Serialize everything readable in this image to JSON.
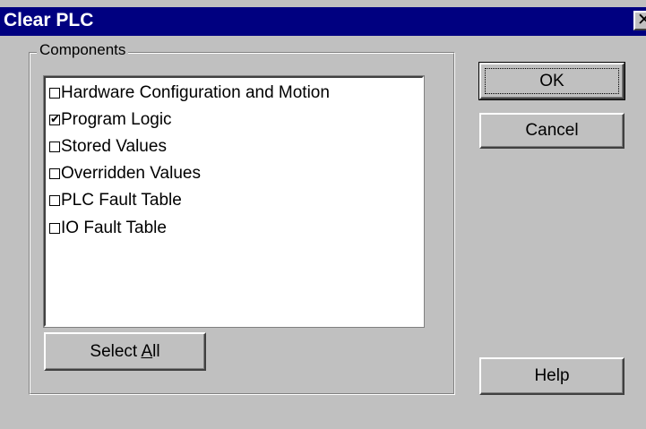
{
  "window": {
    "title": "Clear PLC",
    "close_glyph": "✕"
  },
  "components_group": {
    "label": "Components",
    "items": [
      {
        "label": "Hardware Configuration and Motion",
        "checked": false
      },
      {
        "label": "Program Logic",
        "checked": true
      },
      {
        "label": "Stored Values",
        "checked": false
      },
      {
        "label": "Overridden Values",
        "checked": false
      },
      {
        "label": "PLC Fault Table",
        "checked": false
      },
      {
        "label": "IO Fault Table",
        "checked": false
      }
    ],
    "select_all": {
      "prefix": "Select ",
      "accel": "A",
      "suffix": "ll"
    }
  },
  "buttons": {
    "ok": "OK",
    "cancel": "Cancel",
    "help": "Help"
  },
  "icons": {
    "close": "close-icon",
    "check": "checkmark-icon"
  }
}
